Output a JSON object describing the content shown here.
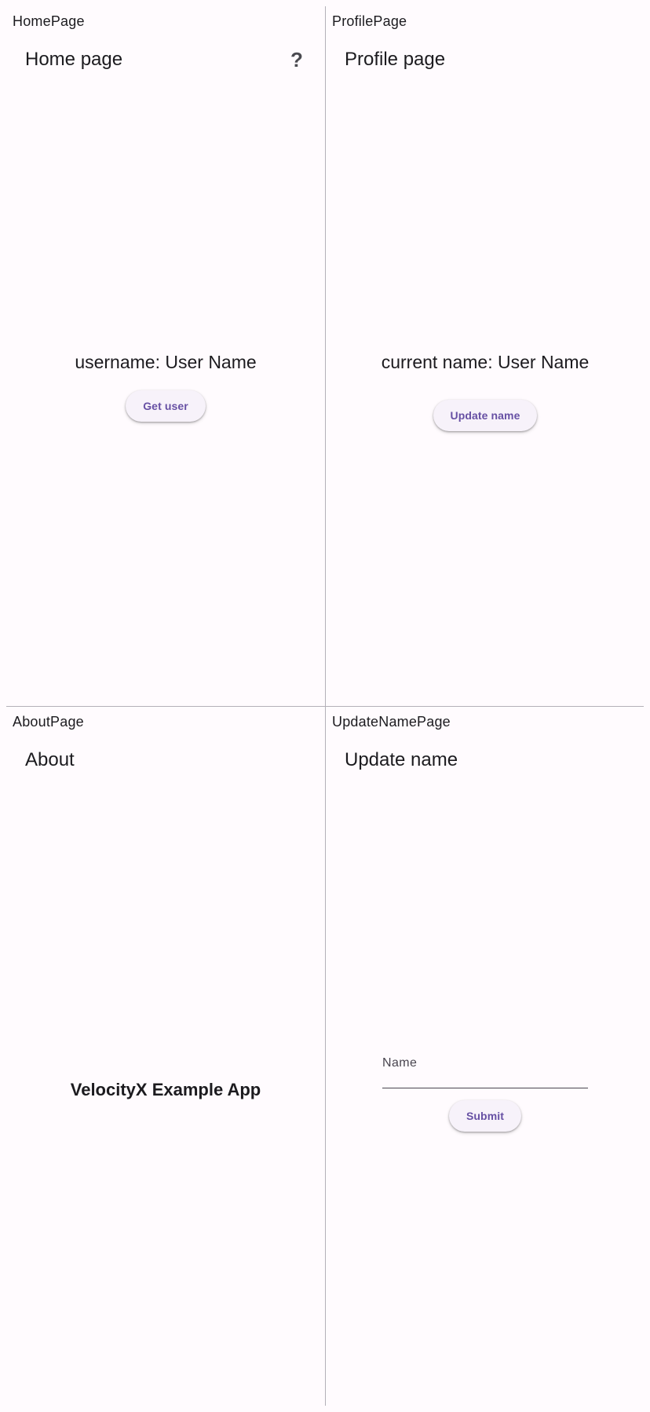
{
  "home": {
    "route_label": "HomePage",
    "title": "Home page",
    "help_icon": "?",
    "username_text": "username: User Name",
    "get_user_label": "Get user"
  },
  "profile": {
    "route_label": "ProfilePage",
    "title": "Profile page",
    "current_name_text": "current name: User Name",
    "update_name_label": "Update name"
  },
  "about": {
    "route_label": "AboutPage",
    "title": "About",
    "app_name": "VelocityX Example App"
  },
  "update_name": {
    "route_label": "UpdateNamePage",
    "title": "Update name",
    "field_label": "Name",
    "field_value": "",
    "submit_label": "Submit"
  },
  "colors": {
    "background": "#fffbfe",
    "primary": "#6750a4",
    "button_surface": "#f7f2fa",
    "divider": "#b3b0b8"
  }
}
